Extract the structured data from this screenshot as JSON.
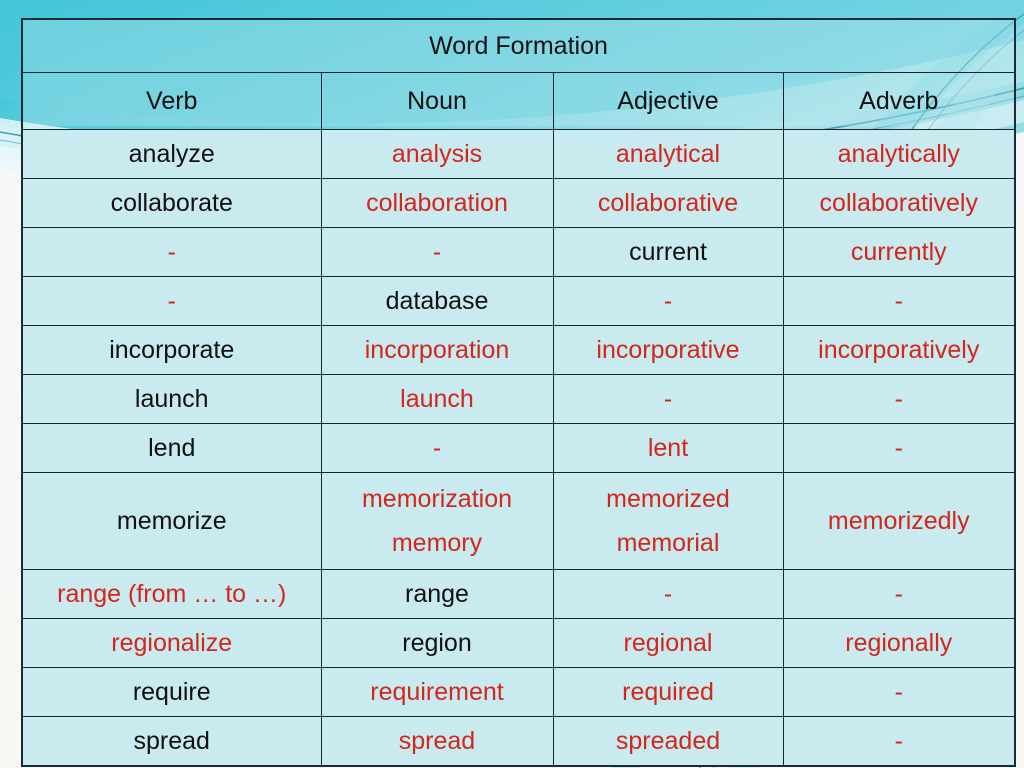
{
  "slide": {
    "title": "Word Formation",
    "background_color": "#f7f7f5",
    "cell_color": "#c9eaee",
    "border_color": "#16252e",
    "accent_red": "#d3261c",
    "accent_black": "#111111",
    "swoosh_colors": [
      "#4fc6d8",
      "#7fd6e2",
      "#bfe8ef",
      "#2a9aa8",
      "#e9f7f9"
    ]
  },
  "table": {
    "columns": [
      {
        "label": "Verb"
      },
      {
        "label": "Noun"
      },
      {
        "label": "Adjective"
      },
      {
        "label": "Adverb"
      }
    ],
    "rows": [
      {
        "verb": {
          "text": "analyze",
          "color": "black"
        },
        "noun": {
          "text": "analysis",
          "color": "red"
        },
        "adjective": {
          "text": "analytical",
          "color": "red"
        },
        "adverb": {
          "text": "analytically",
          "color": "red"
        }
      },
      {
        "verb": {
          "text": "collaborate",
          "color": "black"
        },
        "noun": {
          "text": "collaboration",
          "color": "red"
        },
        "adjective": {
          "text": "collaborative",
          "color": "red"
        },
        "adverb": {
          "text": "collaboratively",
          "color": "red"
        }
      },
      {
        "verb": {
          "text": "-",
          "color": "red"
        },
        "noun": {
          "text": "-",
          "color": "red"
        },
        "adjective": {
          "text": "current",
          "color": "black"
        },
        "adverb": {
          "text": "currently",
          "color": "red"
        }
      },
      {
        "verb": {
          "text": "-",
          "color": "red"
        },
        "noun": {
          "text": "database",
          "color": "black"
        },
        "adjective": {
          "text": "-",
          "color": "red"
        },
        "adverb": {
          "text": "-",
          "color": "red"
        }
      },
      {
        "verb": {
          "text": "incorporate",
          "color": "black"
        },
        "noun": {
          "text": "incorporation",
          "color": "red"
        },
        "adjective": {
          "text": "incorporative",
          "color": "red"
        },
        "adverb": {
          "text": "incorporatively",
          "color": "red"
        }
      },
      {
        "verb": {
          "text": "launch",
          "color": "black"
        },
        "noun": {
          "text": "launch",
          "color": "red"
        },
        "adjective": {
          "text": "-",
          "color": "red"
        },
        "adverb": {
          "text": "-",
          "color": "red"
        }
      },
      {
        "verb": {
          "text": "lend",
          "color": "black"
        },
        "noun": {
          "text": "-",
          "color": "red"
        },
        "adjective": {
          "text": "lent",
          "color": "red"
        },
        "adverb": {
          "text": "-",
          "color": "red"
        }
      },
      {
        "tall": true,
        "verb": {
          "text": "memorize",
          "color": "black"
        },
        "noun": {
          "text": "memorization",
          "color": "red",
          "text2": "memory",
          "color2": "red"
        },
        "adjective": {
          "text": "memorized",
          "color": "red",
          "text2": "memorial",
          "color2": "red"
        },
        "adverb": {
          "text": "memorizedly",
          "color": "red"
        }
      },
      {
        "verb": {
          "text": "range (from … to …)",
          "color": "red"
        },
        "noun": {
          "text": "range",
          "color": "black"
        },
        "adjective": {
          "text": "-",
          "color": "red"
        },
        "adverb": {
          "text": "-",
          "color": "red"
        }
      },
      {
        "verb": {
          "text": "regionalize",
          "color": "red"
        },
        "noun": {
          "text": "region",
          "color": "black"
        },
        "adjective": {
          "text": "regional",
          "color": "red"
        },
        "adverb": {
          "text": "regionally",
          "color": "red"
        }
      },
      {
        "verb": {
          "text": "require",
          "color": "black"
        },
        "noun": {
          "text": "requirement",
          "color": "red"
        },
        "adjective": {
          "text": "required",
          "color": "red"
        },
        "adverb": {
          "text": "-",
          "color": "red"
        }
      },
      {
        "verb": {
          "text": "spread",
          "color": "black"
        },
        "noun": {
          "text": "spread",
          "color": "red"
        },
        "adjective": {
          "text": "spreaded",
          "color": "red"
        },
        "adverb": {
          "text": "-",
          "color": "red"
        }
      }
    ]
  }
}
